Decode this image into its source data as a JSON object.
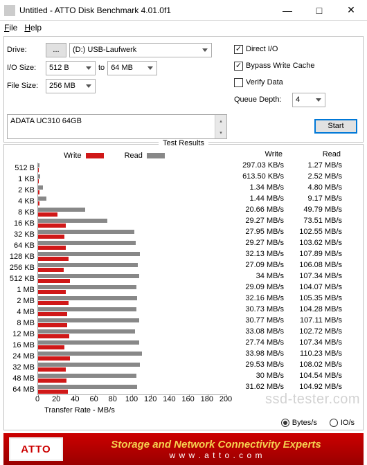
{
  "window": {
    "title": "Untitled - ATTO Disk Benchmark 4.01.0f1",
    "min": "—",
    "max": "□",
    "close": "✕"
  },
  "menu": {
    "file": "File",
    "help": "Help"
  },
  "form": {
    "drive_label": "Drive:",
    "browse": "...",
    "drive_value": "(D:) USB-Laufwerk",
    "iosize_label": "I/O Size:",
    "iosize_from": "512 B",
    "to": "to",
    "iosize_to": "64 MB",
    "filesize_label": "File Size:",
    "filesize": "256 MB",
    "direct_io": "Direct I/O",
    "bypass": "Bypass Write Cache",
    "verify": "Verify Data",
    "qd_label": "Queue Depth:",
    "qd": "4",
    "start": "Start",
    "desc": "ADATA UC310 64GB"
  },
  "results": {
    "title": "Test Results",
    "write_label": "Write",
    "read_label": "Read",
    "xaxis_title": "Transfer Rate - MB/s",
    "bytes": "Bytes/s",
    "ios": "IO/s"
  },
  "chart_data": {
    "type": "bar",
    "xlabel": "Transfer Rate - MB/s",
    "ylabel": "I/O Size",
    "xlim": [
      0,
      200
    ],
    "xticks": [
      0,
      20,
      40,
      60,
      80,
      100,
      120,
      140,
      160,
      180,
      200
    ],
    "series_names": [
      "Write",
      "Read"
    ],
    "units": {
      "write_small": "KB/s",
      "other": "MB/s"
    },
    "rows": [
      {
        "label": "512 B",
        "write": 297.03,
        "write_unit": "KB/s",
        "read": 1.27,
        "read_unit": "MB/s"
      },
      {
        "label": "1 KB",
        "write": 613.5,
        "write_unit": "KB/s",
        "read": 2.52,
        "read_unit": "MB/s"
      },
      {
        "label": "2 KB",
        "write": 1.34,
        "write_unit": "MB/s",
        "read": 4.8,
        "read_unit": "MB/s"
      },
      {
        "label": "4 KB",
        "write": 1.44,
        "write_unit": "MB/s",
        "read": 9.17,
        "read_unit": "MB/s"
      },
      {
        "label": "8 KB",
        "write": 20.66,
        "write_unit": "MB/s",
        "read": 49.79,
        "read_unit": "MB/s"
      },
      {
        "label": "16 KB",
        "write": 29.27,
        "write_unit": "MB/s",
        "read": 73.51,
        "read_unit": "MB/s"
      },
      {
        "label": "32 KB",
        "write": 27.95,
        "write_unit": "MB/s",
        "read": 102.55,
        "read_unit": "MB/s"
      },
      {
        "label": "64 KB",
        "write": 29.27,
        "write_unit": "MB/s",
        "read": 103.62,
        "read_unit": "MB/s"
      },
      {
        "label": "128 KB",
        "write": 32.13,
        "write_unit": "MB/s",
        "read": 107.89,
        "read_unit": "MB/s"
      },
      {
        "label": "256 KB",
        "write": 27.09,
        "write_unit": "MB/s",
        "read": 106.08,
        "read_unit": "MB/s"
      },
      {
        "label": "512 KB",
        "write": 34,
        "write_unit": "MB/s",
        "read": 107.34,
        "read_unit": "MB/s"
      },
      {
        "label": "1 MB",
        "write": 29.09,
        "write_unit": "MB/s",
        "read": 104.07,
        "read_unit": "MB/s"
      },
      {
        "label": "2 MB",
        "write": 32.16,
        "write_unit": "MB/s",
        "read": 105.35,
        "read_unit": "MB/s"
      },
      {
        "label": "4 MB",
        "write": 30.73,
        "write_unit": "MB/s",
        "read": 104.28,
        "read_unit": "MB/s"
      },
      {
        "label": "8 MB",
        "write": 30.77,
        "write_unit": "MB/s",
        "read": 107.11,
        "read_unit": "MB/s"
      },
      {
        "label": "12 MB",
        "write": 33.08,
        "write_unit": "MB/s",
        "read": 102.72,
        "read_unit": "MB/s"
      },
      {
        "label": "16 MB",
        "write": 27.74,
        "write_unit": "MB/s",
        "read": 107.34,
        "read_unit": "MB/s"
      },
      {
        "label": "24 MB",
        "write": 33.98,
        "write_unit": "MB/s",
        "read": 110.23,
        "read_unit": "MB/s"
      },
      {
        "label": "32 MB",
        "write": 29.53,
        "write_unit": "MB/s",
        "read": 108.02,
        "read_unit": "MB/s"
      },
      {
        "label": "48 MB",
        "write": 30,
        "write_unit": "MB/s",
        "read": 104.54,
        "read_unit": "MB/s"
      },
      {
        "label": "64 MB",
        "write": 31.62,
        "write_unit": "MB/s",
        "read": 104.92,
        "read_unit": "MB/s"
      }
    ]
  },
  "footer": {
    "logo": "ATTO",
    "line1": "Storage and Network Connectivity Experts",
    "line2": "w w w . a t t o . c o m"
  },
  "watermark": "ssd-tester.com"
}
